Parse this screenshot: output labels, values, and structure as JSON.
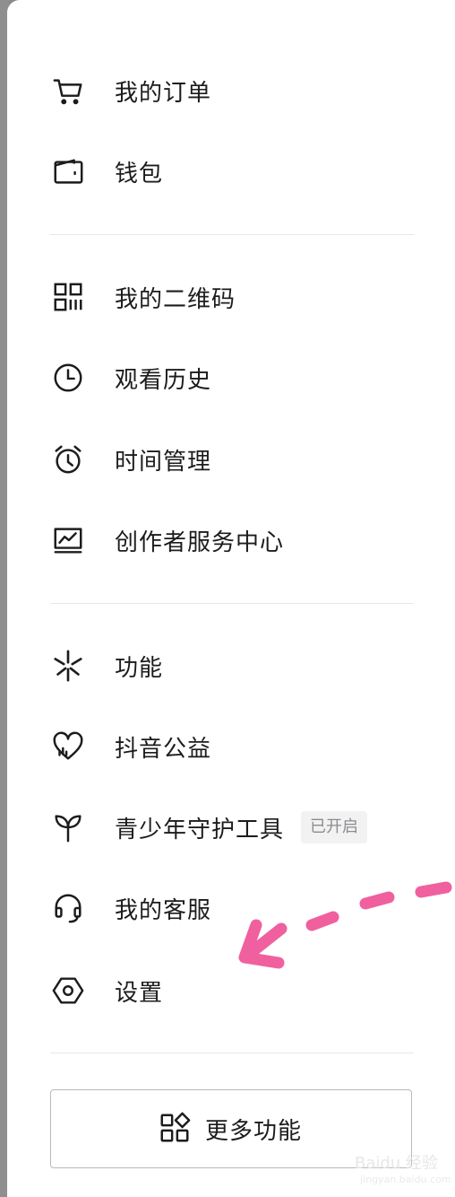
{
  "menu": {
    "section1": [
      {
        "label": "我的订单",
        "icon": "cart-icon"
      },
      {
        "label": "钱包",
        "icon": "wallet-icon"
      }
    ],
    "section2": [
      {
        "label": "我的二维码",
        "icon": "qr-code-icon"
      },
      {
        "label": "观看历史",
        "icon": "clock-icon"
      },
      {
        "label": "时间管理",
        "icon": "alarm-clock-icon"
      },
      {
        "label": "创作者服务中心",
        "icon": "monitor-chart-icon"
      }
    ],
    "section3": [
      {
        "label": "功能",
        "icon": "sparkle-icon"
      },
      {
        "label": "抖音公益",
        "icon": "heart-icon"
      },
      {
        "label": "青少年守护工具",
        "icon": "sprout-icon",
        "badge": "已开启"
      },
      {
        "label": "我的客服",
        "icon": "headset-icon"
      },
      {
        "label": "设置",
        "icon": "hexagon-settings-icon"
      }
    ]
  },
  "more_button": {
    "label": "更多功能",
    "icon": "grid-shapes-icon"
  },
  "annotation": {
    "color": "#f0609e"
  },
  "watermark": {
    "text": "Baidu 经验",
    "sub": "jingyan.baidu.com"
  }
}
